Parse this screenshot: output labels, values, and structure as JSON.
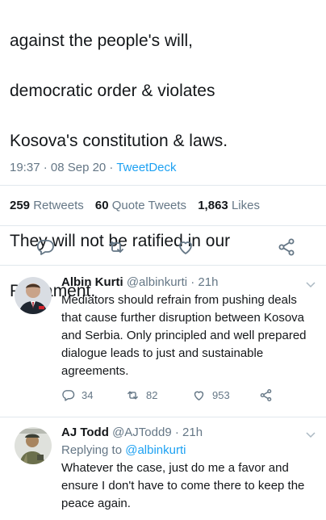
{
  "tweet": {
    "text_line1": "against the people's will,",
    "text_line2": "democratic order & violates",
    "text_line3": "Kosova's constitution & laws.",
    "text_line4": "They will not be ratified in our",
    "text_line5": "Parliament.",
    "time": "19:37 · 08 Sep 20 · ",
    "client": "TweetDeck",
    "retweets_count": "259",
    "retweets_label": "Retweets",
    "quotes_count": "60",
    "quotes_label": "Quote Tweets",
    "likes_count": "1,863",
    "likes_label": "Likes"
  },
  "replies": [
    {
      "name": "Albin Kurti",
      "handle": "@albinkurti",
      "time": "· 21h",
      "text": "Mediators should refrain from pushing deals that cause further disruption between Kosova and Serbia. Only principled and well prepared dialogue leads to just and sustainable agreements.",
      "reply_count": "34",
      "retweet_count": "82",
      "like_count": "953"
    },
    {
      "name": "AJ Todd",
      "handle": "@AJTodd9",
      "time": "· 21h",
      "replying_prefix": "Replying to",
      "replying_to": "@albinkurti",
      "text": "Whatever the case, just do me a favor and ensure I don't have to come there to keep the peace again."
    }
  ],
  "colors": {
    "accent": "#1da1f2",
    "muted": "#657786",
    "text": "#14171a",
    "divider": "#e1e8ed"
  },
  "icons": [
    "reply-icon",
    "retweet-icon",
    "like-icon",
    "share-icon",
    "chevron-down-icon"
  ]
}
